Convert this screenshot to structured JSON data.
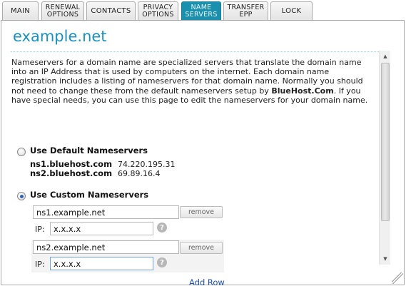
{
  "tabs": [
    {
      "label": "MAIN",
      "active": false
    },
    {
      "label": "RENEWAL OPTIONS",
      "active": false
    },
    {
      "label": "CONTACTS",
      "active": false
    },
    {
      "label": "PRIVACY OPTIONS",
      "active": false
    },
    {
      "label": "NAME SERVERS",
      "active": true
    },
    {
      "label": "TRANSFER EPP",
      "active": false
    },
    {
      "label": "LOCK",
      "active": false
    }
  ],
  "domain": "example.net",
  "description": {
    "part1": "Nameservers for a domain name are specialized servers that translate the domain name into an IP Address that is used by computers on the internet. Each domain name registration includes a listing of nameservers for that domain name. Normally you should not need to change these from the default nameservers setup by ",
    "brand": "BlueHost.Com",
    "part2": ". If you have special needs, you can use this page to edit the nameservers for your domain name."
  },
  "default_option": {
    "label": "Use Default Nameservers",
    "selected": false,
    "servers": [
      {
        "host": "ns1.bluehost.com",
        "ip": "74.220.195.31"
      },
      {
        "host": "ns2.bluehost.com",
        "ip": "69.89.16.4"
      }
    ]
  },
  "custom_option": {
    "label": "Use Custom Nameservers",
    "selected": true,
    "rows": [
      {
        "name": "ns1.example.net",
        "ip_label": "IP:",
        "ip": "x.x.x.x",
        "remove_label": "remove"
      },
      {
        "name": "ns2.example.net",
        "ip_label": "IP:",
        "ip": "x.x.x.x",
        "remove_label": "remove"
      }
    ],
    "add_row_label": "Add Row"
  },
  "icons": {
    "help": "?",
    "scroll_up": "▲",
    "scroll_down": "▼"
  },
  "colors": {
    "accent": "#1a8fae",
    "title": "#1d8fbd",
    "link": "#1f4ea7"
  }
}
